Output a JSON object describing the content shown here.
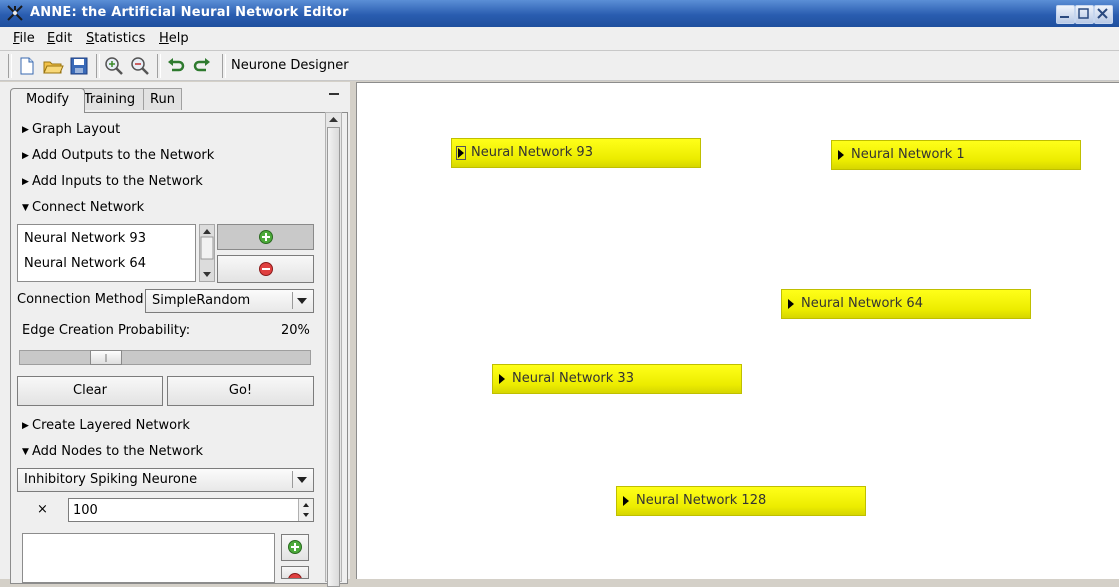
{
  "window": {
    "title": "ANNE: the Artificial Neural Network Editor"
  },
  "menu": [
    {
      "key": "F",
      "rest": "ile"
    },
    {
      "key": "E",
      "rest": "dit"
    },
    {
      "key": "S",
      "rest": "tatistics"
    },
    {
      "key": "H",
      "rest": "elp"
    }
  ],
  "toolbar": {
    "icons": [
      "new-file-icon",
      "open-folder-icon",
      "save-icon",
      "zoom-in-icon",
      "zoom-out-icon",
      "undo-icon",
      "redo-icon"
    ],
    "designer_label": "Neurone Designer"
  },
  "tabs": {
    "modify": "Modify",
    "training": "Training",
    "run": "Run"
  },
  "sections": {
    "graph_layout": "Graph Layout",
    "add_outputs": "Add Outputs to the Network",
    "add_inputs": "Add Inputs to the Network",
    "connect_network": "Connect Network",
    "create_layered": "Create Layered Network",
    "add_nodes": "Add Nodes to the Network"
  },
  "connect": {
    "list": [
      "Neural Network 93",
      "Neural Network 64"
    ],
    "method_label": "Connection Method:",
    "method_value": "SimpleRandom",
    "probability_label": "Edge Creation Probability:",
    "probability_value": "20%",
    "probability": 0.2,
    "clear_label": "Clear",
    "go_label": "Go!"
  },
  "add_nodes": {
    "neurone_type": "Inhibitory Spiking Neurone",
    "multiplier": "×",
    "count": "100"
  },
  "canvas": {
    "nodes": [
      {
        "id": "nn93",
        "label": "Neural Network 93"
      },
      {
        "id": "nn1",
        "label": "Neural Network 1"
      },
      {
        "id": "nn64",
        "label": "Neural Network 64"
      },
      {
        "id": "nn33",
        "label": "Neural Network 33"
      },
      {
        "id": "nn128",
        "label": "Neural Network 128"
      }
    ]
  },
  "colors": {
    "node_fill": "#f0f000",
    "titlebar": "#2a5db0",
    "add": "#3a9a2a",
    "remove": "#d83030"
  }
}
